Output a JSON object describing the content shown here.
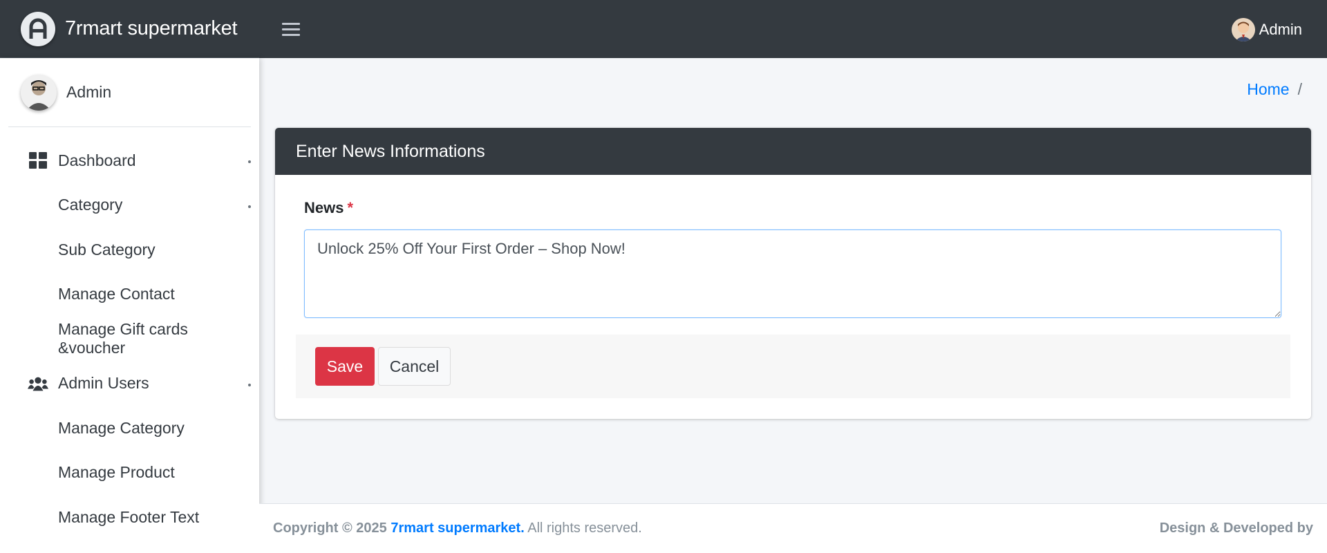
{
  "app": {
    "brand_name": "7rmart supermarket",
    "top_user_name": "Admin"
  },
  "sidebar": {
    "user_name": "Admin",
    "items": [
      {
        "label": "Dashboard",
        "icon": "dashboard-grid-icon",
        "has_caret": true
      },
      {
        "label": "Category",
        "icon": "",
        "has_caret": true
      },
      {
        "label": "Sub Category",
        "icon": "",
        "has_caret": false
      },
      {
        "label": "Manage Contact",
        "icon": "",
        "has_caret": false
      },
      {
        "label": "Manage Gift cards &voucher",
        "icon": "",
        "has_caret": false
      },
      {
        "label": "Admin Users",
        "icon": "users-icon",
        "has_caret": true
      },
      {
        "label": "Manage Category",
        "icon": "",
        "has_caret": false
      },
      {
        "label": "Manage Product",
        "icon": "",
        "has_caret": false
      },
      {
        "label": "Manage Footer Text",
        "icon": "",
        "has_caret": false
      }
    ]
  },
  "breadcrumb": {
    "home": "Home",
    "separator": "/"
  },
  "card": {
    "title": "Enter News Informations",
    "field_label": "News",
    "required_mark": "*",
    "news_value": "Unlock 25% Off Your First Order – Shop Now!",
    "save_label": "Save",
    "cancel_label": "Cancel"
  },
  "footer": {
    "copyright_prefix": "Copyright © 2025",
    "company": "7rmart supermarket.",
    "rights": "All rights reserved.",
    "credit": "Design & Developed by"
  },
  "colors": {
    "navbar": "#343a40",
    "accent": "#007bff",
    "danger": "#dc3545"
  }
}
